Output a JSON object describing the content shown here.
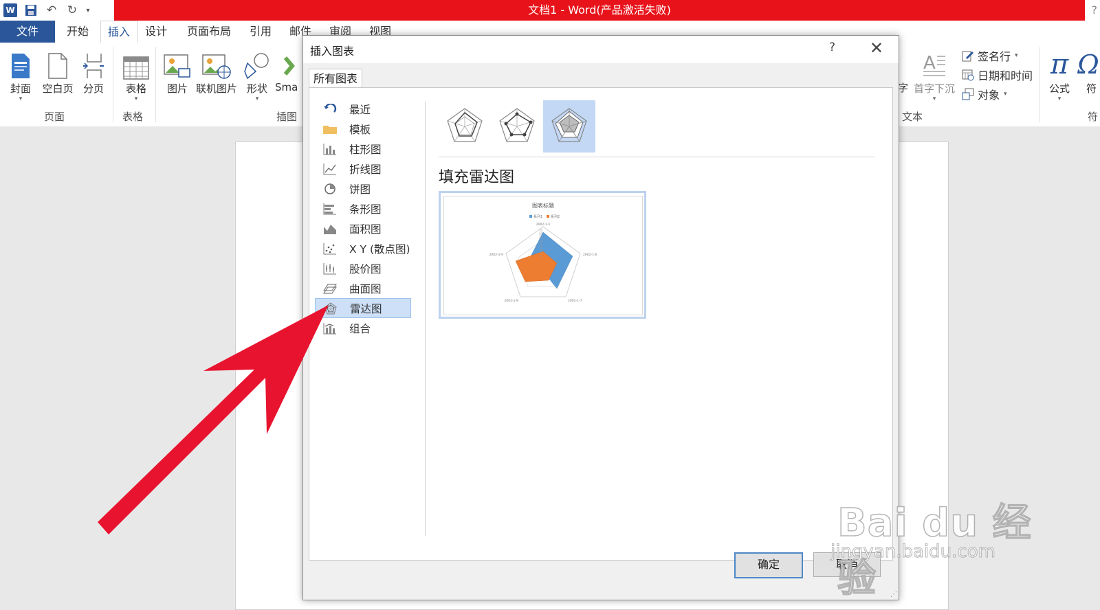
{
  "app": {
    "window_title": "文档1 -  Word(产品激活失败)",
    "help_glyph": "?"
  },
  "ribbon_tabs": [
    "文件",
    "开始",
    "插入",
    "设计",
    "页面布局",
    "引用",
    "邮件",
    "审阅",
    "视图"
  ],
  "active_tab": "插入",
  "ribbon": {
    "pages_group": {
      "label": "页面",
      "buttons": [
        "封面",
        "空白页",
        "分页"
      ]
    },
    "tables_group": {
      "label": "表格",
      "buttons": [
        "表格"
      ]
    },
    "illustrations_group": {
      "label": "插图",
      "buttons": [
        "图片",
        "联机图片",
        "形状",
        "Sma"
      ]
    },
    "text_group": {
      "label": "文本",
      "partial_left": "字",
      "dropcap": "首字下沉",
      "signature_line": "签名行",
      "datetime": "日期和时间",
      "object": "对象"
    },
    "symbols_group": {
      "equation": "公式",
      "symbol": "符",
      "label_partial": "符"
    }
  },
  "dialog": {
    "title": "插入图表",
    "help": "?",
    "tab": "所有图表",
    "categories": [
      "最近",
      "模板",
      "柱形图",
      "折线图",
      "饼图",
      "条形图",
      "面积图",
      "X Y (散点图)",
      "股价图",
      "曲面图",
      "雷达图",
      "组合"
    ],
    "selected_category": "雷达图",
    "selected_subtype_title": "填充雷达图",
    "preview": {
      "chart_title": "图表标题",
      "legend": [
        "系列1",
        "系列2"
      ],
      "axis_labels": [
        "2002-1-5",
        "2002-1-6",
        "2002-1-7",
        "2002-1-8",
        "2002-1-9"
      ],
      "scale_ticks": [
        "0",
        "5",
        "10",
        "15",
        "20",
        "25",
        "30",
        "35"
      ],
      "series_colors": [
        "#5b9bd5",
        "#ed7d31"
      ]
    },
    "ok": "确定",
    "cancel": "取消"
  },
  "watermark": {
    "brand": "Bai du 经验",
    "url": "jingyan.baidu.com"
  },
  "colors": {
    "title_band": "#e8131a",
    "word_blue": "#2b579a",
    "arrow_red": "#e8142f"
  }
}
